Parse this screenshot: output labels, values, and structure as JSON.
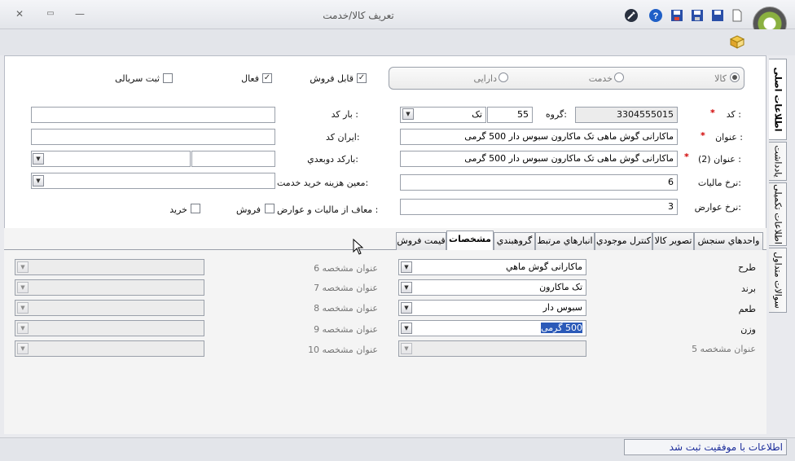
{
  "window": {
    "title": "تعريف کالا/خدمت",
    "close": "✕",
    "restore": "▭",
    "minimize": "—"
  },
  "type_options": [
    {
      "label": "کالا",
      "checked": true
    },
    {
      "label": "خدمت",
      "checked": false
    },
    {
      "label": "دارایی",
      "checked": false
    }
  ],
  "flags": [
    {
      "label": "قابل فروش",
      "checked": true
    },
    {
      "label": "فعال",
      "checked": true
    },
    {
      "label": "ثبت سريالی",
      "checked": false
    }
  ],
  "fields": {
    "code_label": "کد :",
    "code_value": "3304555015",
    "group_label": "گروه:",
    "group_value": "55",
    "group_select": "تک",
    "barcode_label": "بار کد :",
    "barcode_value": "",
    "title_label": "عنوان :",
    "title_value": "ماکارانی گوش ماهی تک ماکارون سبوس دار 500 گرمی",
    "irancode_label": "ایران کد:",
    "irancode_value": "",
    "title2_label": "عنوان (2) :",
    "title2_value": "ماکارانی گوش ماهی تک ماکارون سبوس دار 500 گرمی",
    "secbarcode_label": "بارکد دوبعدي:",
    "tax_label": "نرخ مالیات:",
    "tax_value": "6",
    "costcenter_label": "معین هزینه خرید خدمت:",
    "duty_label": "نرخ عوارض:",
    "duty_value": "3",
    "exempt_label": "معاف از مالیات و عوارض :",
    "exempt_sale": "فروش",
    "exempt_buy": "خرید",
    "required_mark": "*"
  },
  "tabs": [
    {
      "label": "واحدهاي سنجش",
      "active": false
    },
    {
      "label": "تصوير کالا",
      "active": false
    },
    {
      "label": "کنترل موجودي",
      "active": false
    },
    {
      "label": "انبارهاي مرتبط",
      "active": false
    },
    {
      "label": "گروهبندي",
      "active": false
    },
    {
      "label": "مشخصات",
      "active": true
    },
    {
      "label": "قیمت فروش",
      "active": false
    }
  ],
  "side_tabs": [
    {
      "label": "اطلاعات اصلی",
      "active": true
    },
    {
      "label": "یادداشت",
      "active": false
    },
    {
      "label": "اطلاعات تکمیلی",
      "active": false
    },
    {
      "label": "سوالات متداول",
      "active": false
    }
  ],
  "specs_left": [
    {
      "label": "طرح",
      "value": "ماکارانی گوش ماهي"
    },
    {
      "label": "برند",
      "value": "تک ماکارون"
    },
    {
      "label": "طعم",
      "value": "سبوس دار"
    },
    {
      "label": "وزن",
      "value": "500 گرمی"
    },
    {
      "label": "عنوان مشخصه 5",
      "value": ""
    }
  ],
  "specs_right": [
    {
      "label": "عنوان مشخصه 6"
    },
    {
      "label": "عنوان مشخصه 7"
    },
    {
      "label": "عنوان مشخصه 8"
    },
    {
      "label": "عنوان مشخصه 9"
    },
    {
      "label": "عنوان مشخصه 10"
    }
  ],
  "status": "اطلاعات با موفقیت ثبت شد",
  "colors": {
    "accent": "#1b2c9a",
    "required": "#d00000",
    "selection": "#2b5ab8"
  }
}
